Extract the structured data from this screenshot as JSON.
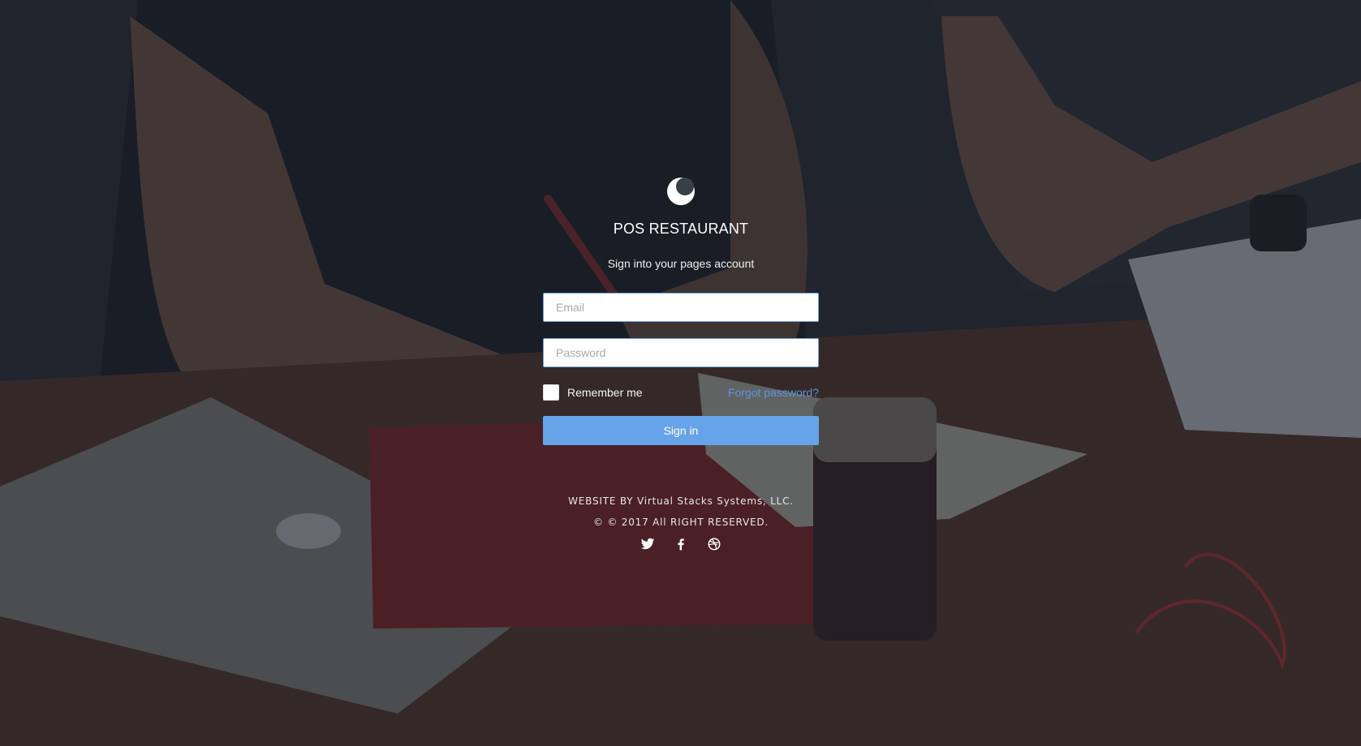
{
  "brand": {
    "logo_icon": "crescent-logo-icon",
    "title": "POS RESTAURANT",
    "subtitle": "Sign into your pages account"
  },
  "form": {
    "email_placeholder": "Email",
    "email_value": "",
    "password_placeholder": "Password",
    "password_value": "",
    "remember_label": "Remember me",
    "remember_checked": false,
    "forgot_label": "Forgot password?",
    "signin_label": "Sign in"
  },
  "footer": {
    "credit": "WEBSITE BY Virtual Stacks Systems, LLC.",
    "copyright": "© © 2017 All RIGHT RESERVED.",
    "social": [
      "twitter-icon",
      "facebook-icon",
      "dribbble-icon"
    ]
  },
  "colors": {
    "accent": "#66a3e8",
    "link": "#5c97da",
    "overlay": "#161c26"
  }
}
